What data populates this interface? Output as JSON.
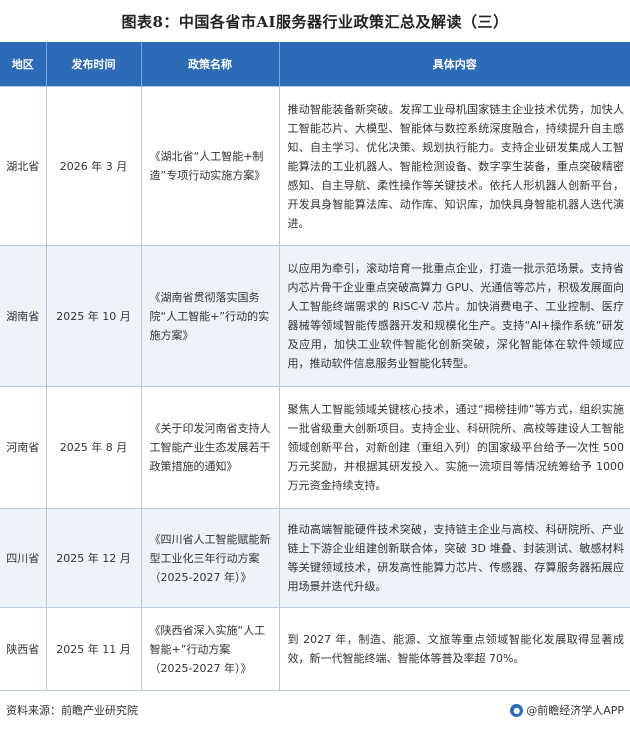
{
  "title": "图表8：中国各省市AI服务器行业政策汇总及解读（三）",
  "table": {
    "headers": [
      "地区",
      "发布时间",
      "政策名称",
      "具体内容"
    ],
    "rows": [
      {
        "region": "湖北省",
        "date": "2026 年 3 月",
        "policy": "《湖北省“人工智能+制造”专项行动实施方案》",
        "content": "推动智能装备新突破。发挥工业母机国家链主企业技术优势，加快人工智能芯片、大模型、智能体与数控系统深度融合，持续提升自主感知、自主学习、优化决策、规划执行能力。支持企业研发集成人工智能算法的工业机器人、智能检测设备、数字孪生装备，重点突破精密感知、自主导航、柔性操作等关键技术。依托人形机器人创新平台，开发具身智能算法库、动作库、知识库，加快具身智能机器人迭代演进。"
      },
      {
        "region": "湖南省",
        "date": "2025 年 10 月",
        "policy": "《湖南省贯彻落实国务院“人工智能+”行动的实施方案》",
        "content": "以应用为牵引，滚动培育一批重点企业，打造一批示范场景。支持省内芯片骨干企业重点突破高算力 GPU、光通信等芯片，积极发展面向人工智能终端需求的 RISC-V 芯片。加快消费电子、工业控制、医疗器械等领域智能传感器开发和规模化生产。支持“AI+操作系统”研发及应用，加快工业软件智能化创新突破，深化智能体在软件领域应用，推动软件信息服务业智能化转型。"
      },
      {
        "region": "河南省",
        "date": "2025 年 8 月",
        "policy": "《关于印发河南省支持人工智能产业生态发展若干政策措施的通知》",
        "content": "聚焦人工智能领域关键核心技术，通过“揭榜挂帅”等方式，组织实施一批省级重大创新项目。支持企业、科研院所、高校等建设人工智能领域创新平台，对新创建（重组入列）的国家级平台给予一次性 500 万元奖励，并根据其研发投入、实施一流项目等情况统筹给予 1000 万元资金持续支持。"
      },
      {
        "region": "四川省",
        "date": "2025 年 12 月",
        "policy": "《四川省人工智能赋能新型工业化三年行动方案（2025-2027 年）》",
        "content": "推动高端智能硬件技术突破，支持链主企业与高校、科研院所、产业链上下游企业组建创新联合体，突破 3D 堆叠、封装测试、敏感材料等关键领域技术，研发高性能算力芯片、传感器、存算服务器拓展应用场景并迭代升级。"
      },
      {
        "region": "陕西省",
        "date": "2025 年 11 月",
        "policy": "《陕西省深入实施“人工智能+”行动方案（2025-2027 年）》",
        "content": "到 2027 年，制造、能源、文旅等重点领域智能化发展取得显著成效，新一代智能终端、智能体等普及率超 70%。"
      }
    ]
  },
  "footer": {
    "source": "资料来源：前瞻产业研究院",
    "brand": "@前瞻经济学人APP"
  }
}
